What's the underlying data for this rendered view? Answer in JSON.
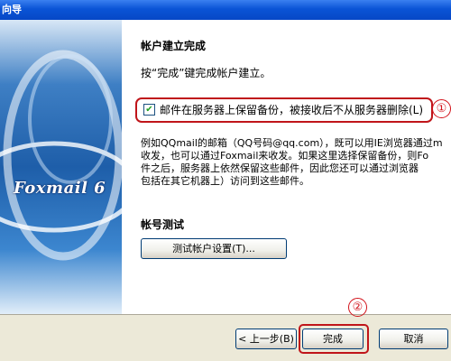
{
  "window": {
    "title": "向导"
  },
  "banner": {
    "brand": "Foxmail 6"
  },
  "page": {
    "heading": "帐户建立完成",
    "instruction": "按“完成”键完成帐户建立。",
    "checkbox": {
      "label": "邮件在服务器上保留备份，被接收后不从服务器删除(L)",
      "checked": true
    },
    "description": "例如QQmail的邮箱（QQ号码@qq.com），既可以用IE浏览器通过m\n收发，也可以通过Foxmail来收发。如果这里选择保留备份，则Fo\n件之后，服务器上依然保留这些邮件，因此您还可以通过浏览器\n包括在其它机器上）访问到这些邮件。",
    "account_test_heading": "帐号测试",
    "test_button": "测试帐户设置(T)..."
  },
  "footer": {
    "back_button": "< 上一步(B)",
    "finish_button": "完成",
    "cancel_button": "取消"
  },
  "annotations": {
    "marker1": "①",
    "marker2": "②"
  },
  "colors": {
    "annotation_red": "#c0151a",
    "title_bar": "#0a54d6",
    "dialog_bg": "#ece9d8"
  }
}
